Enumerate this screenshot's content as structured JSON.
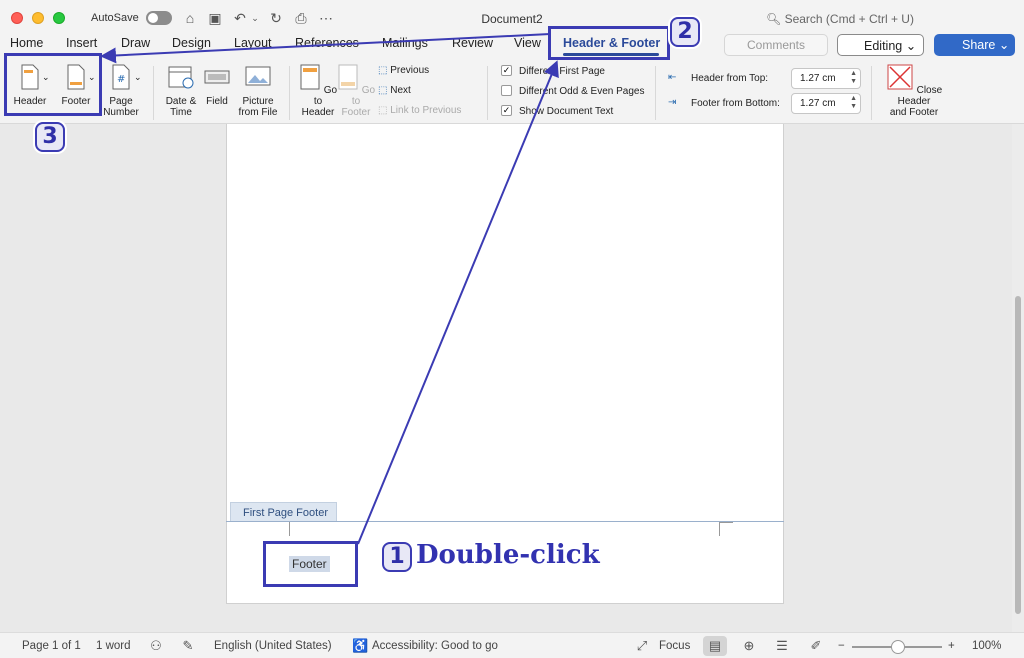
{
  "window": {
    "title": "Document2",
    "autosave_label": "AutoSave",
    "search_placeholder": "Search (Cmd + Ctrl + U)"
  },
  "tabs": [
    "Home",
    "Insert",
    "Draw",
    "Design",
    "Layout",
    "References",
    "Mailings",
    "Review",
    "View",
    "Header & Footer"
  ],
  "active_tab": "Header & Footer",
  "actions": {
    "comments": "Comments",
    "editing": "Editing",
    "share": "Share"
  },
  "ribbon": {
    "header": "Header",
    "footer": "Footer",
    "page_number": [
      "Page",
      "Number"
    ],
    "date_time": [
      "Date &",
      "Time"
    ],
    "field": "Field",
    "picture": [
      "Picture",
      "from File"
    ],
    "go_header": [
      "Go to",
      "Header"
    ],
    "go_footer": [
      "Go to",
      "Footer"
    ],
    "previous": "Previous",
    "next": "Next",
    "link_previous": "Link to Previous",
    "diff_first": "Different First Page",
    "diff_odd_even": "Different Odd & Even Pages",
    "show_text": "Show Document Text",
    "header_from_top_label": "Header from Top:",
    "header_from_top_value": "1.27 cm",
    "footer_from_bottom_label": "Footer from Bottom:",
    "footer_from_bottom_value": "1.27 cm",
    "close": [
      "Close Header",
      "and Footer"
    ]
  },
  "document": {
    "footer_tab": "First Page Footer",
    "footer_text": "Footer"
  },
  "status": {
    "page": "Page 1 of 1",
    "words": "1 word",
    "language": "English (United States)",
    "accessibility": "Accessibility: Good to go",
    "focus": "Focus",
    "zoom": "100%"
  },
  "annotations": {
    "step1": "1",
    "step1_text": "Double-click",
    "step2": "2",
    "step3": "3"
  },
  "colors": {
    "accent": "#2b4a9a",
    "annotation": "#3b3bb3",
    "share": "#3169c7"
  }
}
